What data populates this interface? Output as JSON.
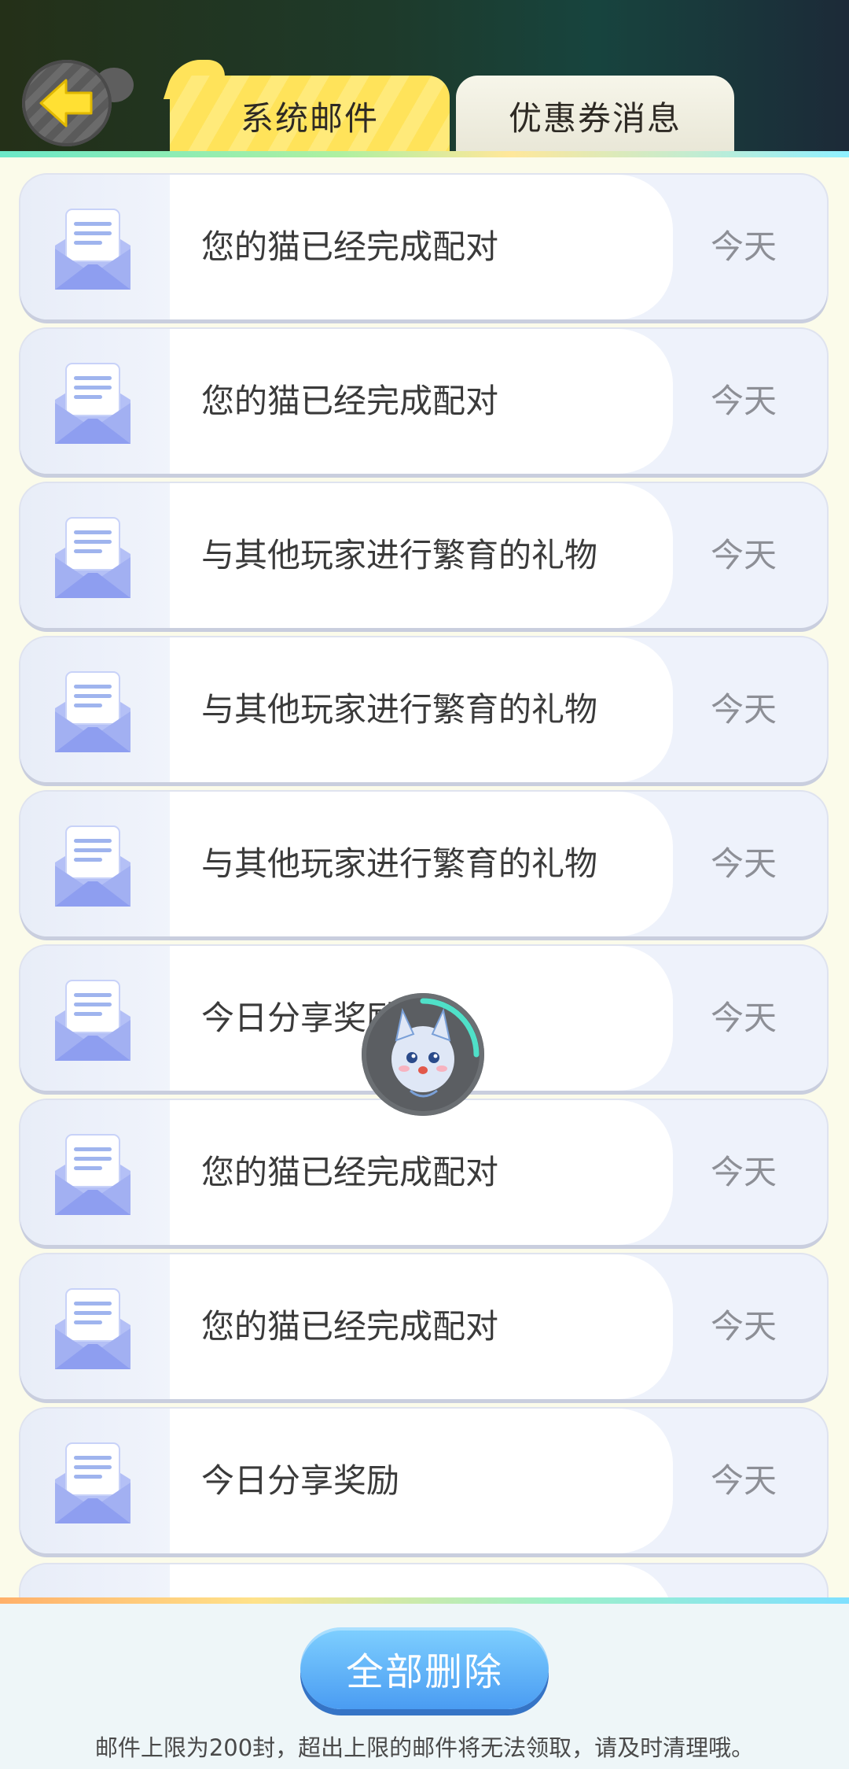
{
  "header": {
    "tabs": [
      {
        "label": "系统邮件",
        "active": true
      },
      {
        "label": "优惠券消息",
        "active": false
      }
    ]
  },
  "mails": [
    {
      "title": "您的猫已经完成配对",
      "date": "今天"
    },
    {
      "title": "您的猫已经完成配对",
      "date": "今天"
    },
    {
      "title": "与其他玩家进行繁育的礼物",
      "date": "今天"
    },
    {
      "title": "与其他玩家进行繁育的礼物",
      "date": "今天"
    },
    {
      "title": "与其他玩家进行繁育的礼物",
      "date": "今天"
    },
    {
      "title": "今日分享奖励",
      "date": "今天"
    },
    {
      "title": "您的猫已经完成配对",
      "date": "今天"
    },
    {
      "title": "您的猫已经完成配对",
      "date": "今天"
    },
    {
      "title": "今日分享奖励",
      "date": "今天"
    }
  ],
  "footer": {
    "delete_all_label": "全部删除",
    "note": "邮件上限为200封，超出上限的邮件将无法领取，请及时清理哦。"
  },
  "colors": {
    "active_tab": "#ffe35a",
    "delete_button": "#4a9cf2",
    "envelope": "#a9b6f4"
  }
}
